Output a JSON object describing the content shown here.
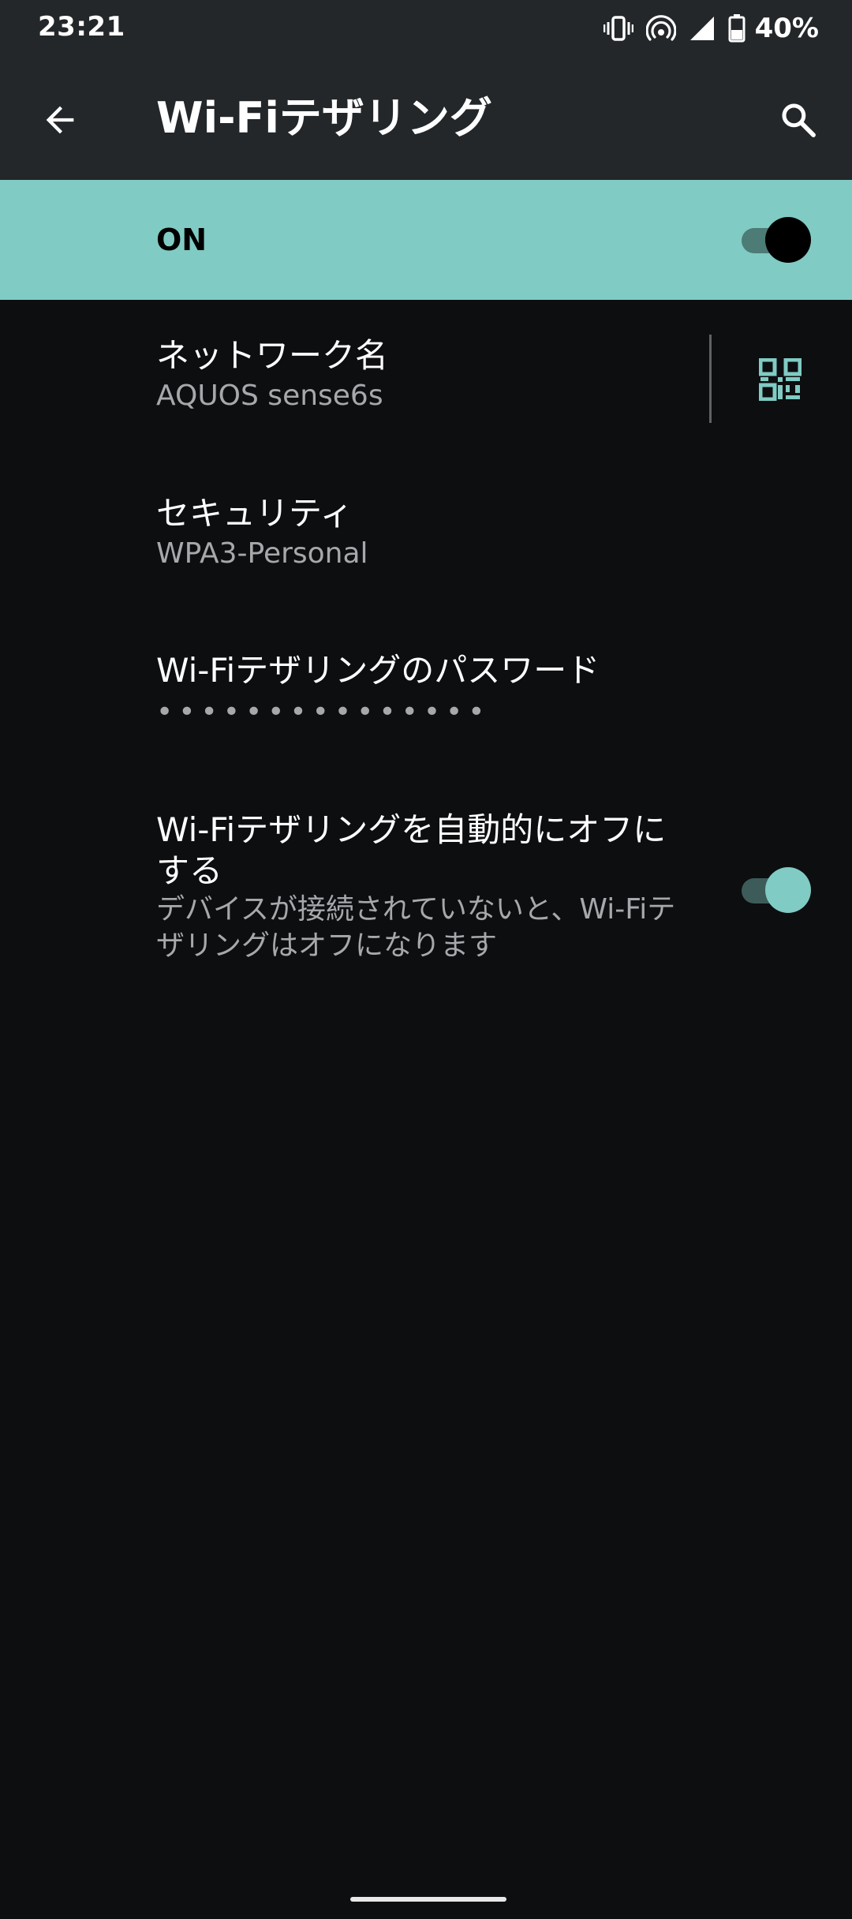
{
  "status_bar": {
    "time": "23:21",
    "battery_percent": "40%",
    "icons": [
      "vibrate-icon",
      "hotspot-icon",
      "cell-signal-icon",
      "battery-icon"
    ]
  },
  "app_bar": {
    "title": "Wi-Fiテザリング",
    "back_icon": "arrow-back-icon",
    "search_icon": "search-icon"
  },
  "master_switch": {
    "label": "ON",
    "checked": true
  },
  "preferences": {
    "network_name": {
      "title": "ネットワーク名",
      "summary": "AQUOS sense6s",
      "action_icon": "qr-code-icon"
    },
    "security": {
      "title": "セキュリティ",
      "summary": "WPA3-Personal"
    },
    "password": {
      "title": "Wi-Fiテザリングのパスワード",
      "summary": "•••••••••••••••"
    },
    "auto_off": {
      "title": "Wi-Fiテザリングを自動的にオフにする",
      "summary": "デバイスが接続されていないと、Wi-Fiテザリングはオフになります",
      "checked": true
    }
  },
  "colors": {
    "accent": "#80cbc4",
    "app_bar": "#23272a",
    "background": "#0d0e10",
    "summary_text": "#a6a8ab"
  }
}
